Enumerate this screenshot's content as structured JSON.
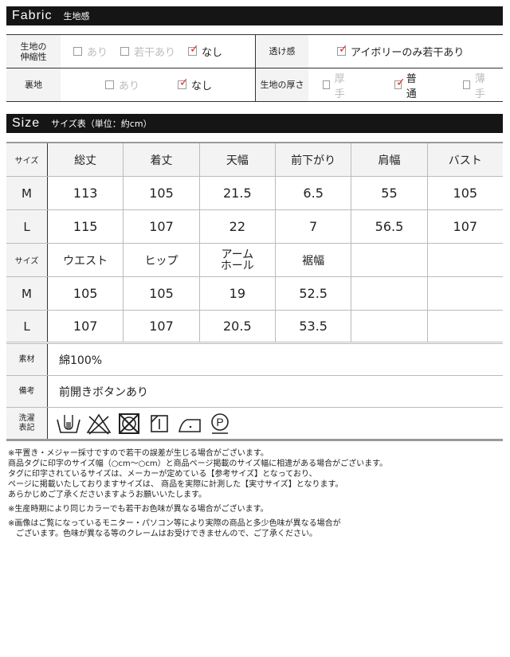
{
  "fabric_section": {
    "title_en": "Fabric",
    "title_jp": "生地感"
  },
  "fabric": {
    "stretch": {
      "label_line1": "生地の",
      "label_line2": "伸縮性",
      "options": [
        {
          "label": "あり",
          "checked": false
        },
        {
          "label": "若干あり",
          "checked": false
        },
        {
          "label": "なし",
          "checked": true
        }
      ]
    },
    "sheer": {
      "label": "透け感",
      "options": [
        {
          "label": "アイボリーのみ若干あり",
          "checked": true
        }
      ]
    },
    "lining": {
      "label": "裏地",
      "options": [
        {
          "label": "あり",
          "checked": false
        },
        {
          "label": "なし",
          "checked": true
        }
      ]
    },
    "thickness": {
      "label": "生地の厚さ",
      "options": [
        {
          "label": "厚手",
          "checked": false
        },
        {
          "label": "普通",
          "checked": true
        },
        {
          "label": "薄手",
          "checked": false
        }
      ]
    }
  },
  "size_section": {
    "title_en": "Size",
    "title_jp": "サイズ表（単位：約cm）"
  },
  "size_table1": {
    "size_label": "サイズ",
    "headers": [
      "総丈",
      "着丈",
      "天幅",
      "前下がり",
      "肩幅",
      "バスト"
    ],
    "rows": [
      {
        "size": "M",
        "values": [
          "113",
          "105",
          "21.5",
          "6.5",
          "55",
          "105"
        ]
      },
      {
        "size": "L",
        "values": [
          "115",
          "107",
          "22",
          "7",
          "56.5",
          "107"
        ]
      }
    ]
  },
  "size_table2": {
    "size_label": "サイズ",
    "headers": [
      "ウエスト",
      "ヒップ",
      "アーム\nホール",
      "裾幅",
      "",
      ""
    ],
    "headers_armhole_line1": "アーム",
    "headers_armhole_line2": "ホール",
    "rows": [
      {
        "size": "M",
        "values": [
          "105",
          "105",
          "19",
          "52.5",
          "",
          ""
        ]
      },
      {
        "size": "L",
        "values": [
          "107",
          "107",
          "20.5",
          "53.5",
          "",
          ""
        ]
      }
    ]
  },
  "details": {
    "material": {
      "label": "素材",
      "value": "綿100%"
    },
    "notes": {
      "label": "備考",
      "value": "前開きボタンあり"
    },
    "care": {
      "label_line1": "洗濯",
      "label_line2": "表記",
      "icons": [
        "hand-wash-icon",
        "no-bleach-icon",
        "no-tumble-dry-icon",
        "drip-dry-shade-icon",
        "iron-low-icon",
        "dry-clean-p-icon"
      ]
    }
  },
  "footnotes": [
    "※平置き・メジャー採寸ですので若干の誤差が生じる場合がございます。",
    "商品タグに印字のサイズ幅（○cm〜○cm）と商品ページ掲載のサイズ幅に相違がある場合がございます。",
    "タグに印字されているサイズは、メーカーが定めている【参考サイズ】となっており、",
    "ページに掲載いたしておりますサイズは、 商品を実際に計測した【実寸サイズ】となります。",
    "あらかじめご了承くださいますようお願いいたします。",
    "※生産時期により同じカラーでも若干お色味が異なる場合がございます。",
    "※画像はご覧になっているモニター・パソコン等により実際の商品と多少色味が異なる場合が",
    "　ございます。色味が異なる等のクレームはお受けできませんので、ご了承ください。"
  ]
}
